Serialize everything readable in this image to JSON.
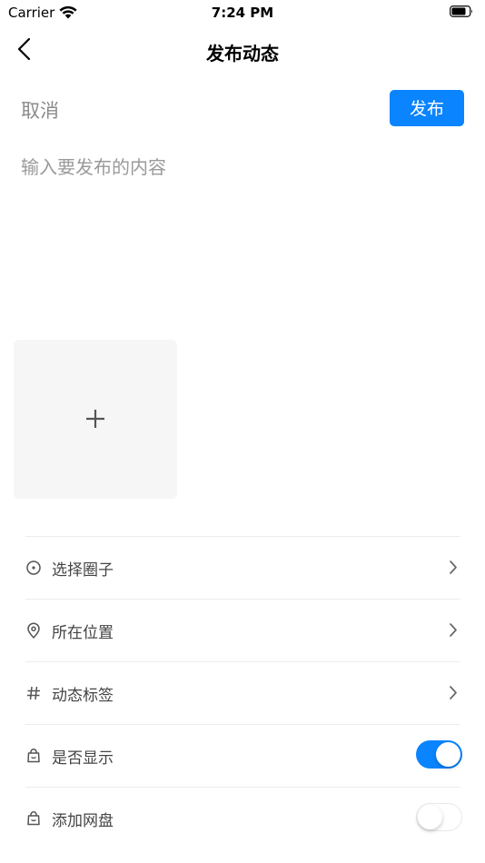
{
  "status_bar": {
    "carrier": "Carrier",
    "time": "7:24 PM"
  },
  "nav": {
    "title": "发布动态",
    "back_icon": "chevron-left-icon"
  },
  "actions": {
    "cancel_label": "取消",
    "publish_label": "发布"
  },
  "compose": {
    "placeholder": "输入要发布的内容",
    "value": ""
  },
  "media": {
    "add_icon": "plus-icon"
  },
  "options": [
    {
      "label": "选择圈子",
      "icon": "circle-dot-icon",
      "control": "chevron"
    },
    {
      "label": "所在位置",
      "icon": "location-pin-icon",
      "control": "chevron"
    },
    {
      "label": "动态标签",
      "icon": "hashtag-icon",
      "control": "chevron"
    },
    {
      "label": "是否显示",
      "icon": "lock-bag-icon",
      "control": "toggle",
      "on": true
    },
    {
      "label": "添加网盘",
      "icon": "lock-bag-icon",
      "control": "toggle",
      "on": false
    }
  ],
  "colors": {
    "accent": "#0a84ff",
    "tile_bg": "#f6f6f6",
    "muted_text": "#8a8a8a"
  }
}
